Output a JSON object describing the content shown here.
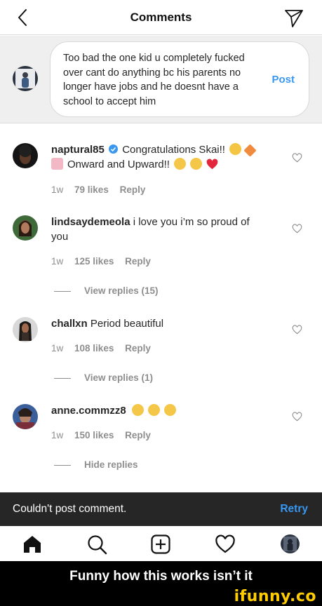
{
  "header": {
    "title": "Comments",
    "back_icon": "chevron-left-icon",
    "send_icon": "paper-plane-icon"
  },
  "composer": {
    "text": "Too bad the one kid u completely fucked over cant do anything bc his parents no longer have jobs and he doesnt have a school to accept him",
    "post_label": "Post"
  },
  "comments": [
    {
      "username": "naptural85",
      "verified": true,
      "text": "Congratulations Skai!!",
      "text_line2": "Onward and Upward!!",
      "time": "1w",
      "likes": "79 likes",
      "reply": "Reply"
    },
    {
      "username": "lindsaydemeola",
      "text": "i love you i’m so proud of you",
      "time": "1w",
      "likes": "125 likes",
      "reply": "Reply",
      "replies_label": "View replies (15)"
    },
    {
      "username": "challxn",
      "text": "Period beautiful",
      "time": "1w",
      "likes": "108 likes",
      "reply": "Reply",
      "replies_label": "View replies (1)"
    },
    {
      "username": "anne.commzz8",
      "text": "",
      "time": "1w",
      "likes": "150 likes",
      "reply": "Reply",
      "replies_label": "Hide replies"
    }
  ],
  "toast": {
    "message": "Couldn't post comment.",
    "action": "Retry"
  },
  "tabbar": {
    "icons": [
      "home-icon",
      "search-icon",
      "add-icon",
      "heart-icon",
      "profile-icon"
    ]
  },
  "caption": "Funny how this works isn’t it",
  "watermark": "ifunny.co",
  "colors": {
    "accent": "#3897f0",
    "toast_bg": "#262626",
    "watermark": "#ffcc00",
    "heart": "#ed4956"
  }
}
